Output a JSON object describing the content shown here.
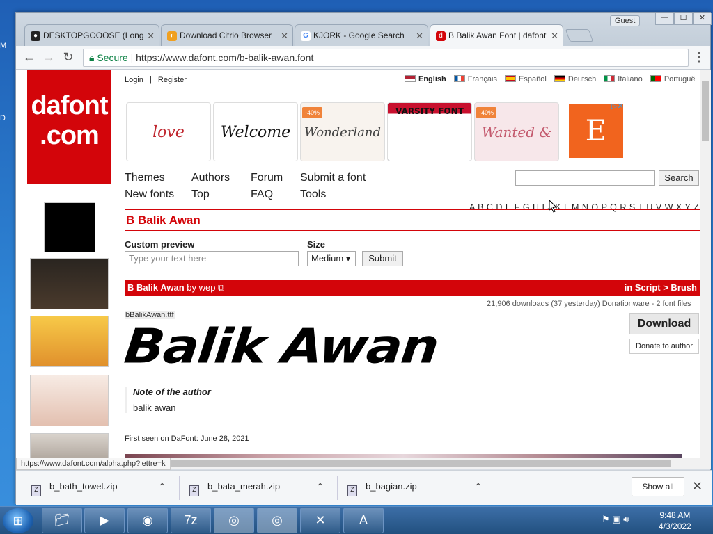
{
  "window": {
    "guest_label": "Guest",
    "min": "—",
    "max": "☐",
    "close": "✕"
  },
  "tabs": [
    {
      "label": "DESKTOPGOOOSE (Long",
      "icon": "github-icon",
      "active": false
    },
    {
      "label": "Download Citrio Browser",
      "icon": "citrio-icon",
      "active": false
    },
    {
      "label": "KJORK - Google Search",
      "icon": "google-icon",
      "active": false
    },
    {
      "label": "B Balik Awan Font | dafont",
      "icon": "dafont-icon",
      "active": true
    }
  ],
  "tab_close": "✕",
  "toolbar": {
    "back": "←",
    "forward": "→",
    "reload": "↻",
    "secure_label": "Secure",
    "url": "https://www.dafont.com/b-balik-awan.font",
    "menu": "⋮"
  },
  "site": {
    "logo_line1": "dafont",
    "logo_line2": ".com",
    "login": "Login",
    "sep": "|",
    "register": "Register",
    "languages": [
      {
        "label": "English",
        "bold": true
      },
      {
        "label": "Français",
        "bold": false
      },
      {
        "label": "Español",
        "bold": false
      },
      {
        "label": "Deutsch",
        "bold": false
      },
      {
        "label": "Italiano",
        "bold": false
      },
      {
        "label": "Portuguê",
        "bold": false
      }
    ],
    "ads": [
      {
        "text": "love",
        "badge": ""
      },
      {
        "text": "Welcome",
        "badge": ""
      },
      {
        "text": "Wonderland",
        "badge": "-40%"
      },
      {
        "text": "VARSITY FONT",
        "badge": ""
      },
      {
        "text": "Wanted & Wild",
        "badge": "-40%"
      }
    ],
    "etsy_letter": "E",
    "nav_row1": [
      "Themes",
      "Authors",
      "Forum",
      "Submit a font"
    ],
    "nav_row2": [
      "New fonts",
      "Top",
      "FAQ",
      "Tools"
    ],
    "search_button": "Search",
    "alphabet": "A B C D E F G H I J K L M N O P Q R S T U V W X Y Z #",
    "font_title": "B Balik Awan",
    "custom_preview_label": "Custom preview",
    "preview_placeholder": "Type your text here",
    "size_label": "Size",
    "size_value": "Medium ▾",
    "submit": "Submit",
    "bar_font_name": "B Balik Awan",
    "bar_by": " by wep ⧉",
    "bar_category": "in Script > Brush",
    "downloads_meta": "21,906 downloads (37 yesterday)    Donationware - 2 font files",
    "download_button": "Download",
    "donate_button": "Donate to author",
    "ttf_name": "bBalikAwan.ttf",
    "sample_text": "Balik Awan",
    "note_title": "Note of the author",
    "note_text": "balik awan",
    "first_seen": "First seen on DaFont: June 28, 2021"
  },
  "status_url": "https://www.dafont.com/alpha.php?lettre=k",
  "downloads": [
    {
      "name": "b_bath_towel.zip"
    },
    {
      "name": "b_bata_merah.zip"
    },
    {
      "name": "b_bagian.zip"
    }
  ],
  "show_all": "Show all",
  "clock": {
    "time": "9:48 AM",
    "date": "4/3/2022"
  },
  "colors": {
    "dafont_red": "#d3050a",
    "secure_green": "#0b8043",
    "taskbar": "#2b5d93"
  }
}
